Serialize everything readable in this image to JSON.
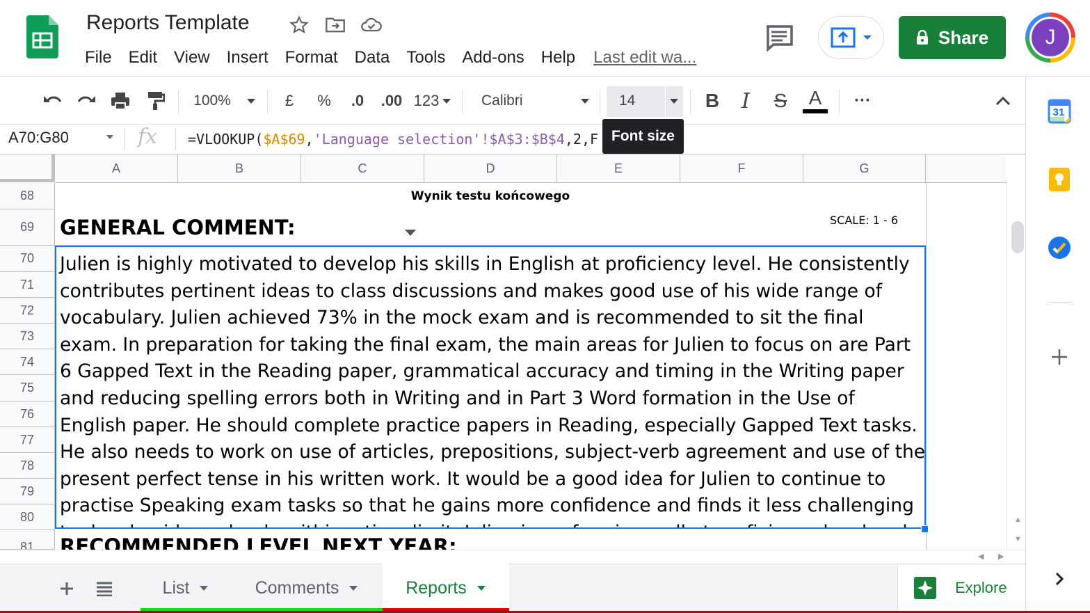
{
  "document": {
    "title": "Reports Template",
    "last_edit": "Last edit wa..."
  },
  "menu": [
    "File",
    "Edit",
    "View",
    "Insert",
    "Format",
    "Data",
    "Tools",
    "Add-ons",
    "Help"
  ],
  "header_actions": {
    "share_label": "Share",
    "avatar_initial": "J"
  },
  "toolbar": {
    "zoom": "100%",
    "currency": "£",
    "percent": "%",
    "decrease_decimal": ".0",
    "increase_decimal": ".00",
    "more_formats": "123",
    "font": "Calibri",
    "font_size": "14",
    "bold": "B",
    "italic": "I",
    "strikethrough": "S",
    "text_color": "A",
    "more": "···",
    "tooltip": "Font size"
  },
  "formula_bar": {
    "name_box": "A70:G80",
    "fx_label": "fx",
    "formula_parts": [
      "=VLOOKUP(",
      "$A$69",
      ",",
      "'Language selection'!$A$3:$B$4",
      ",2,F"
    ]
  },
  "grid": {
    "columns": [
      "A",
      "B",
      "C",
      "D",
      "E",
      "F",
      "G"
    ],
    "rows": [
      "68",
      "69",
      "70",
      "71",
      "72",
      "73",
      "74",
      "75",
      "76",
      "77",
      "78",
      "79",
      "80",
      "81"
    ],
    "row68_title": "Wynik testu końcowego",
    "general_comment": "GENERAL COMMENT:",
    "scale": "SCALE: 1 - 6",
    "merged_comment": "Julien is highly motivated to develop his skills in English at proficiency level.  He consistently contributes pertinent ideas to class discussions and makes good use of his wide range of vocabulary. Julien achieved 73% in the mock exam and is recommended to sit the final exam. In preparation for taking the final exam, the main areas for Julien to focus on are Part 6 Gapped Text in the Reading paper, grammatical accuracy and timing in the Writing paper and reducing spelling errors both in Writing and in Part 3 Word formation in the Use of English paper.  He should complete practice papers in Reading, especially Gapped Text tasks.  He also needs to work on use of articles, prepositions, subject-verb agreement and use of the present perfect tense in his written work.  It would be a good idea for Julien to continue to practise Speaking exam tasks so that he gains more confidence and finds it less challenging to develop ideas clearly within a time limit. Julien is performing well at proficiency level and we all wish him",
    "recommended": "RECOMMENDED LEVEL NEXT YEAR:"
  },
  "sheets": [
    {
      "name": "List",
      "color": "#00e600",
      "active": false
    },
    {
      "name": "Comments",
      "color": "#00e600",
      "active": false
    },
    {
      "name": "Reports",
      "color": "#e60000",
      "active": true
    }
  ],
  "explore_label": "Explore",
  "side_panel": [
    "calendar-icon",
    "keep-icon",
    "tasks-icon",
    "add-icon"
  ],
  "calendar_day": "31",
  "colors": {
    "accent_green": "#188038",
    "selection_blue": "#1a73e8"
  }
}
